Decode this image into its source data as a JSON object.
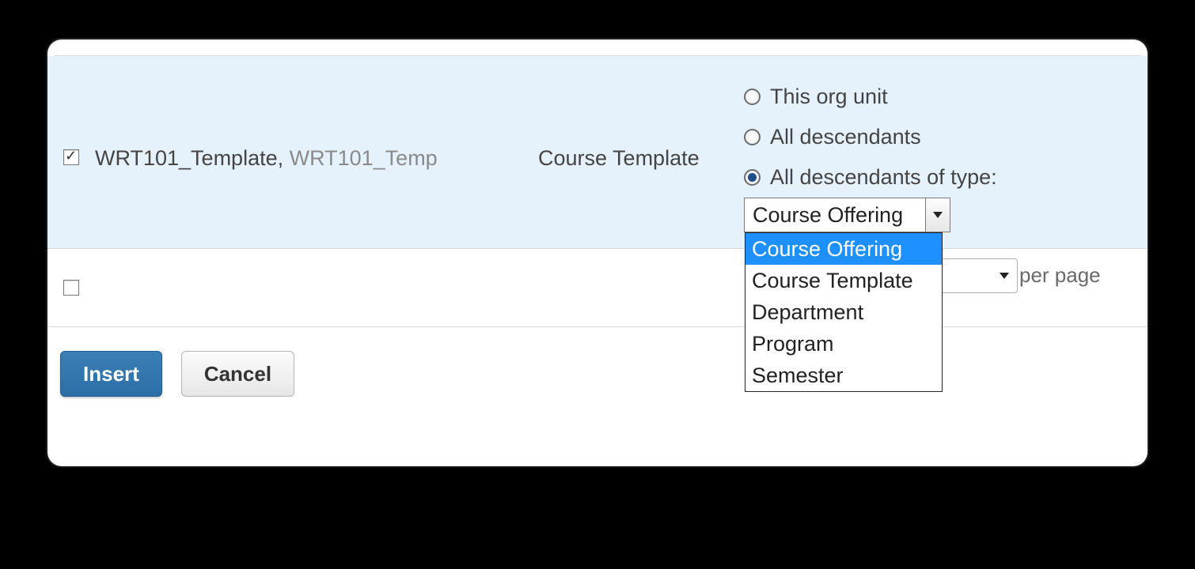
{
  "row": {
    "bold_name": "WRT101_Template",
    "dim_name": "WRT101_Temp",
    "type": "Course Template",
    "row_checked": true,
    "scope": {
      "opt1": "This org unit",
      "opt2": "All descendants",
      "opt3": "All descendants of type:",
      "selected_index": 2,
      "type_select_value": "Course Offering",
      "type_options": [
        "Course Offering",
        "Course Template",
        "Department",
        "Program",
        "Semester"
      ],
      "type_highlight_index": 0
    }
  },
  "pager": {
    "per_page_label": "per page"
  },
  "buttons": {
    "insert": "Insert",
    "cancel": "Cancel"
  }
}
